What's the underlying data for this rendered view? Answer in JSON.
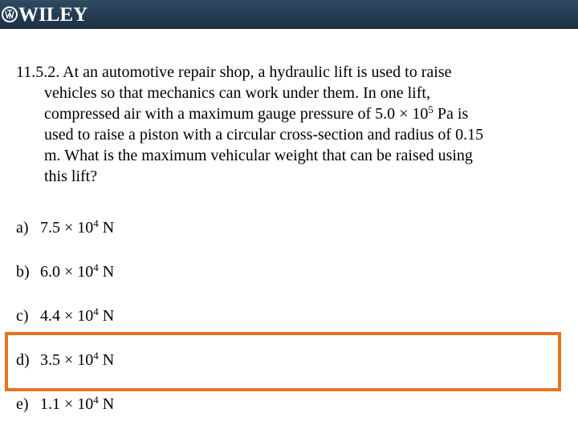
{
  "header": {
    "brand": "WILEY",
    "logo_icon": "wiley-logo-icon",
    "background": "#243c52"
  },
  "question": {
    "number": "11.5.2.",
    "lines": [
      "At an automotive repair shop, a hydraulic lift is used to raise",
      "vehicles so that mechanics can work under them.  In one lift,",
      "compressed air with a maximum gauge pressure of 5.0 × 10",
      "5",
      " Pa is",
      "used to raise a piston with a circular cross-section and radius of 0.15",
      "m.  What is the maximum vehicular weight that can be raised using",
      "this lift?"
    ]
  },
  "options": [
    {
      "letter": "a)",
      "mantissa": "7.5 × 10",
      "exponent": "4",
      "unit": " N"
    },
    {
      "letter": "b)",
      "mantissa": "6.0 × 10",
      "exponent": "4",
      "unit": " N"
    },
    {
      "letter": "c)",
      "mantissa": "4.4 × 10",
      "exponent": "4",
      "unit": " N"
    },
    {
      "letter": "d)",
      "mantissa": "3.5 × 10",
      "exponent": "4",
      "unit": " N"
    },
    {
      "letter": "e)",
      "mantissa": "1.1 × 10",
      "exponent": "4",
      "unit": " N"
    }
  ],
  "highlight": {
    "selected_option": "d)",
    "color": "#e8731e"
  }
}
